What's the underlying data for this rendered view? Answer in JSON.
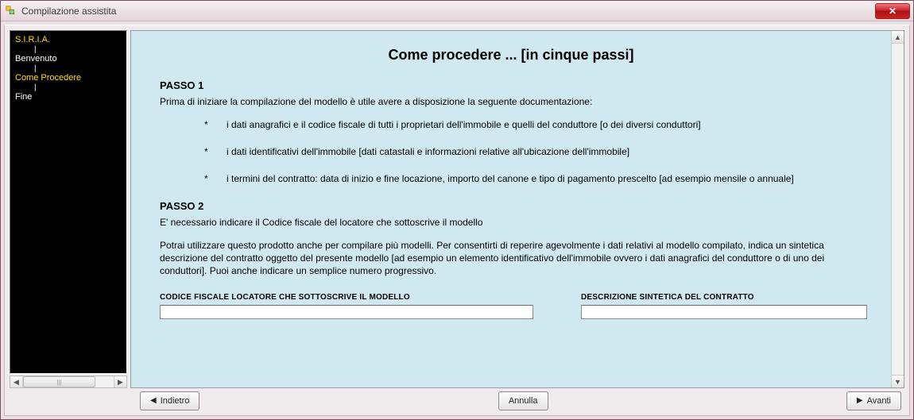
{
  "window": {
    "title": "Compilazione assistita"
  },
  "sidebar": {
    "items": [
      {
        "label": "S.I.R.I.A.",
        "highlight": true
      },
      {
        "label": "Benvenuto",
        "highlight": false
      },
      {
        "label": "Come Procedere",
        "highlight": true
      },
      {
        "label": "Fine",
        "highlight": false
      }
    ]
  },
  "content": {
    "title": "Come procedere ... [in cinque passi]",
    "step1": {
      "label": "PASSO 1",
      "lead": "Prima di iniziare la compilazione del modello è utile avere a disposizione la seguente documentazione:",
      "bullet1": "i dati anagrafici e il codice fiscale di tutti i  proprietari dell'immobile e quelli del conduttore [o dei diversi conduttori]",
      "bullet2": "i dati identificativi dell'immobile [dati catastali e informazioni relative all'ubicazione dell'immobile]",
      "bullet3": "i termini del contratto:  data di inizio e fine locazione, importo del canone e tipo di pagamento prescelto [ad esempio mensile o annuale]"
    },
    "step2": {
      "label": "PASSO 2",
      "lead": "E' necessario indicare il Codice fiscale del locatore che sottoscrive il modello",
      "paragraph": "Potrai utilizzare questo prodotto anche per compilare più modelli. Per consentirti di reperire agevolmente i dati relativi al modello compilato, indica un sintetica descrizione del contratto oggetto del presente modello [ad esempio un elemento identificativo dell'immobile ovvero i dati anagrafici del conduttore o di uno dei conduttori]. Puoi anche indicare un semplice numero progressivo."
    },
    "fields": {
      "codfisc": {
        "label": "CODICE FISCALE LOCATORE CHE SOTTOSCRIVE IL MODELLO",
        "value": ""
      },
      "desc": {
        "label": "DESCRIZIONE SINTETICA DEL CONTRATTO",
        "value": ""
      }
    }
  },
  "footer": {
    "back": "Indietro",
    "cancel": "Annulla",
    "next": "Avanti"
  },
  "glyphs": {
    "star": "*",
    "left": "◀",
    "right": "▶",
    "up": "▲",
    "down": "▼",
    "thumb": "|||"
  }
}
